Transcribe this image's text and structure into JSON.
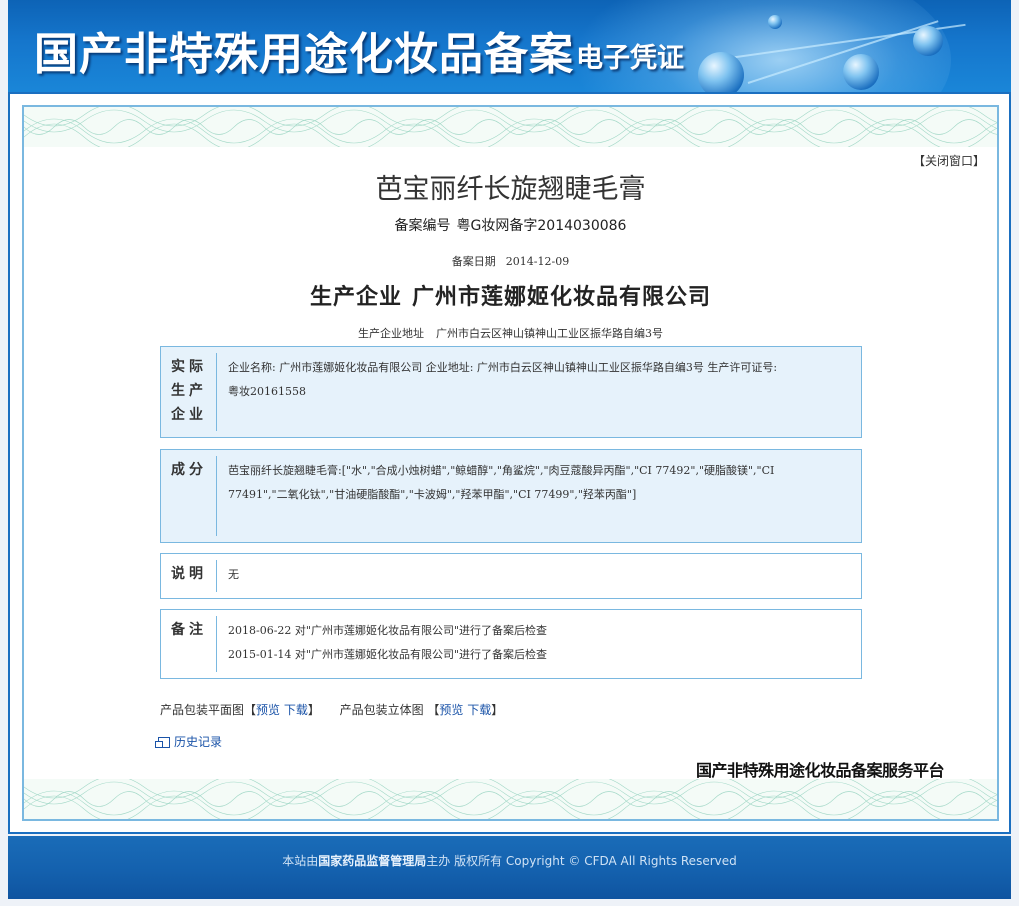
{
  "header": {
    "title": "国产非特殊用途化妆品备案",
    "subtitle": "电子凭证"
  },
  "close_window": "【关闭窗口】",
  "product_name": "芭宝丽纤长旋翘睫毛膏",
  "registration": {
    "number_label": "备案编号",
    "number": "粤G妆网备字2014030086",
    "date_label": "备案日期",
    "date": "2014-12-09"
  },
  "manufacturer": {
    "label": "生产企业",
    "name": "广州市莲娜姬化妆品有限公司",
    "address_label": "生产企业地址",
    "address": "广州市白云区神山镇神山工业区振华路自编3号"
  },
  "sections": {
    "actual_producer": {
      "heading": "实际生产企业",
      "lines": [
        "企业名称: 广州市莲娜姬化妆品有限公司 企业地址: 广州市白云区神山镇神山工业区振华路自编3号 生产许可证号:",
        "粤妆20161558"
      ]
    },
    "ingredients": {
      "heading": "成分",
      "lines": [
        "芭宝丽纤长旋翘睫毛膏:[\"水\",\"合成小烛树蜡\",\"鲸蜡醇\",\"角鲨烷\",\"肉豆蔻酸异丙酯\",\"CI 77492\",\"硬脂酸镁\",\"CI",
        "77491\",\"二氧化钛\",\"甘油硬脂酸酯\",\"卡波姆\",\"羟苯甲酯\",\"CI 77499\",\"羟苯丙酯\"]"
      ]
    },
    "notes": {
      "heading": "说明",
      "lines": [
        "无"
      ]
    },
    "remarks": {
      "heading": "备注",
      "lines": [
        "2018-06-22 对\"广州市莲娜姬化妆品有限公司\"进行了备案后检查",
        "2015-01-14 对\"广州市莲娜姬化妆品有限公司\"进行了备案后检查"
      ]
    }
  },
  "packaging": {
    "flat_label": "产品包装平面图",
    "solid_label": "产品包装立体图",
    "bracket_open": "【",
    "bracket_close": "】",
    "preview": "预览",
    "download": "下载"
  },
  "history_link": "历史记录",
  "platform_name": "国产非特殊用途化妆品备案服务平台",
  "footer": {
    "prefix": "本站由",
    "org": "国家药品监督管理局",
    "suffix": "主办 版权所有 Copyright © CFDA All Rights Reserved"
  },
  "colors": {
    "header_blue": "#1576cc",
    "border_blue": "#7ab8e0",
    "box_fill": "#e6f2fb",
    "link_blue": "#1a53a8",
    "footer_blue": "#1461ae"
  }
}
